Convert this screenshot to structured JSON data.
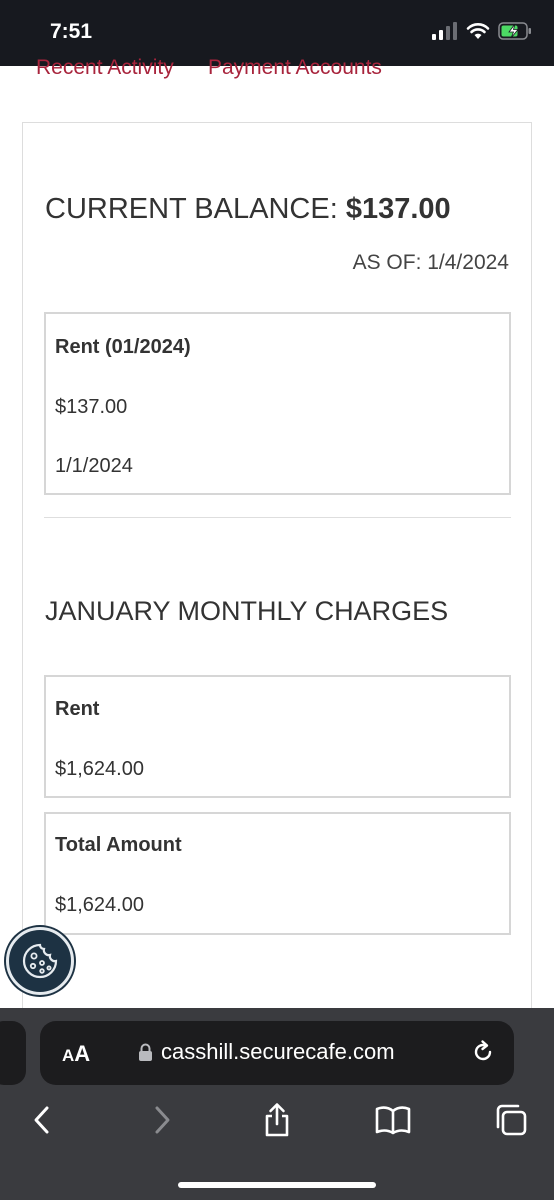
{
  "status_bar": {
    "time": "7:51"
  },
  "nav": {
    "recent_activity": "Recent Activity",
    "payment_accounts": "Payment Accounts"
  },
  "balance": {
    "label": "CURRENT BALANCE:",
    "amount": "$137.00",
    "as_of": "AS OF: 1/4/2024"
  },
  "balance_item": {
    "title": "Rent (01/2024)",
    "amount": "$137.00",
    "date": "1/1/2024"
  },
  "monthly": {
    "title": "JANUARY MONTHLY CHARGES",
    "rent_label": "Rent",
    "rent_amount": "$1,624.00",
    "total_label": "Total Amount",
    "total_amount": "$1,624.00"
  },
  "browser": {
    "text_size_small": "A",
    "text_size_big": "A",
    "url": "casshill.securecafe.com"
  },
  "colors": {
    "accent": "#a8243c",
    "status_bar": "#17191f",
    "cookie": "#1d3243",
    "battery": "#4cd964"
  },
  "icons": [
    "signal-icon",
    "wifi-icon",
    "battery-charging-icon",
    "cookie-icon",
    "lock-icon",
    "reload-icon",
    "back-icon",
    "forward-icon",
    "share-icon",
    "bookmarks-icon",
    "tabs-icon"
  ]
}
